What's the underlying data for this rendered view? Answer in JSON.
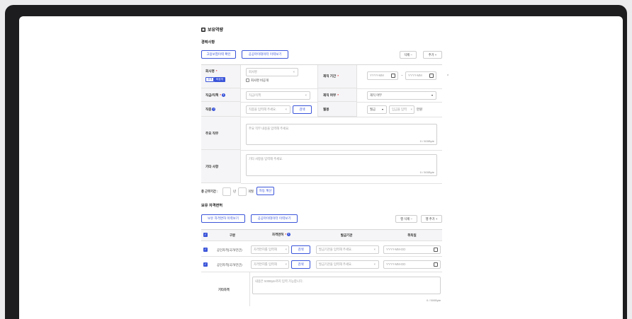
{
  "page_title": "보유역량",
  "career": {
    "section_title": "경력사항",
    "btn_employment": "고용보험이력 확인",
    "btn_public_data": "공공마이데이터 이력보기",
    "btn_delete": "삭제 −",
    "btn_add": "추가 +",
    "company_label": "회사명",
    "company_tag_public": "공개",
    "company_tag_private": "비공개",
    "company_placeholder": "회사명",
    "company_private_checkbox": "회사명 비공개",
    "period_label": "재직 기간",
    "date_placeholder_start": "YYYY-MM",
    "date_sep": "~",
    "date_placeholder_end": "YYYY-MM",
    "position_label": "직급/직책",
    "position_placeholder": "직급/직책",
    "employed_label": "재직 여부",
    "employed_value": "재직 여부",
    "job_label": "직종",
    "job_placeholder": "직종을 입력해 주세요.",
    "job_search": "검색",
    "salary_label": "월봉",
    "salary_type": "월급",
    "salary_placeholder": "임금을 입력",
    "salary_unit": "만원",
    "duties_label": "주요 직무",
    "duties_placeholder": "주요 직무 내용을 입력해 주세요.",
    "duties_count": "0 / 500Byte",
    "etc_label": "기타 사항",
    "etc_placeholder": "기타 사항을 입력해 주세요.",
    "etc_count": "0 / 500Byte",
    "total_label": "총 근무기간 :",
    "total_year": "년",
    "total_month": "개월",
    "auto_calc": "자동 계산"
  },
  "certs": {
    "section_title": "보유 자격면허",
    "btn_certs": "보유 자격면허 이력보기",
    "btn_public_data": "공공마이데이터 이력보기",
    "btn_row_delete": "행 삭제 −",
    "btn_row_add": "행 추가 +",
    "col_type": "구분",
    "col_name": "자격면허",
    "col_issuer": "발급기관",
    "col_date": "취득일",
    "rows": [
      {
        "type": "공인자격(국가/민간)",
        "name_placeholder": "자격면허를 입력해",
        "search": "검색",
        "issuer_placeholder": "발급기관을 입력해 주세요.",
        "date_placeholder": "YYYY-MM-DD"
      },
      {
        "type": "공인자격(국가/민간)",
        "name_placeholder": "자격면허를 입력해",
        "search": "검색",
        "issuer_placeholder": "발급기관을 입력해 주세요.",
        "date_placeholder": "YYYY-MM-DD"
      }
    ],
    "etc_label": "기타자격",
    "etc_placeholder": "내용은 500Byte까지 입력 가능합니다.",
    "etc_count": "0 / 500Byte"
  }
}
